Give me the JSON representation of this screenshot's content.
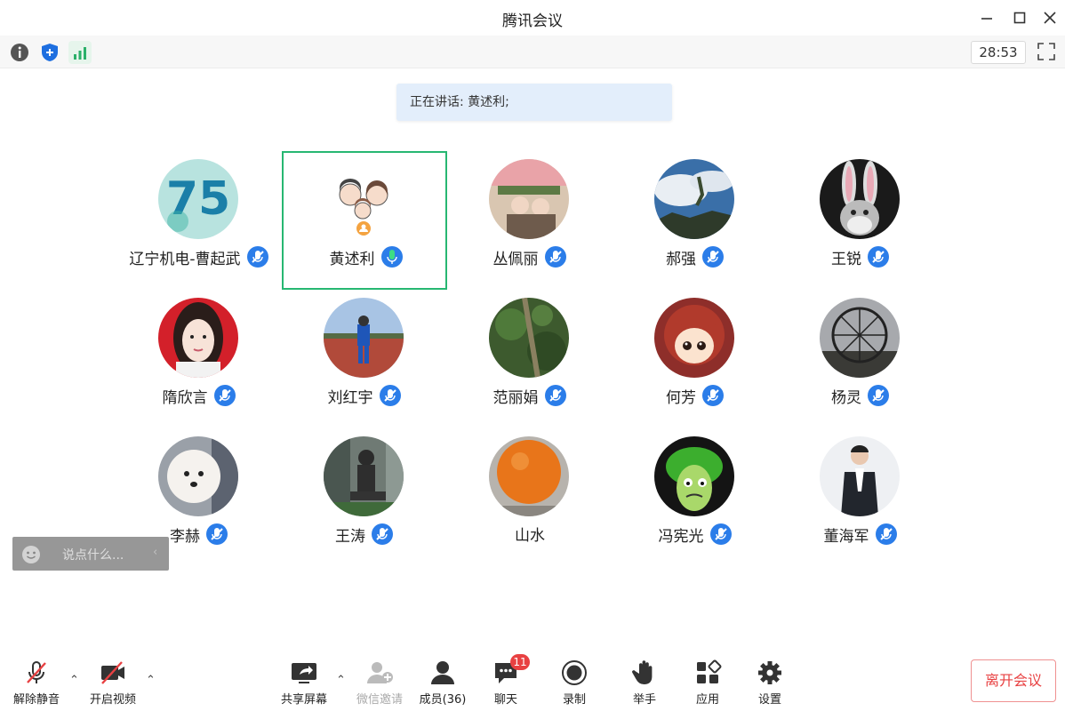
{
  "window": {
    "title": "腾讯会议"
  },
  "status": {
    "icons": [
      "info-icon",
      "security-shield-icon",
      "network-signal-icon"
    ],
    "timer": "28:53"
  },
  "banner": {
    "text": "正在讲话: 黄述利;"
  },
  "participants": [
    {
      "name": "辽宁机电-曹起武",
      "mic": "muted"
    },
    {
      "name": "黄述利",
      "mic": "speaking",
      "active": true
    },
    {
      "name": "丛佩丽",
      "mic": "muted"
    },
    {
      "name": "郝强",
      "mic": "muted"
    },
    {
      "name": "王锐",
      "mic": "muted"
    },
    {
      "name": "隋欣言",
      "mic": "muted"
    },
    {
      "name": "刘红宇",
      "mic": "muted"
    },
    {
      "name": "范丽娟",
      "mic": "muted"
    },
    {
      "name": "何芳",
      "mic": "muted"
    },
    {
      "name": "杨灵",
      "mic": "muted"
    },
    {
      "name": "李赫",
      "mic": "muted"
    },
    {
      "name": "王涛",
      "mic": "muted"
    },
    {
      "name": "山水",
      "mic": "none"
    },
    {
      "name": "冯宪光",
      "mic": "muted"
    },
    {
      "name": "董海军",
      "mic": "muted"
    }
  ],
  "chat_input": {
    "placeholder": "说点什么..."
  },
  "toolbar": {
    "unmute": "解除静音",
    "start_video": "开启视频",
    "share_screen": "共享屏幕",
    "wechat_invite": "微信邀请",
    "members": "成员(36)",
    "chat": "聊天",
    "chat_badge": "11",
    "record": "录制",
    "raise_hand": "举手",
    "apps": "应用",
    "settings": "设置"
  },
  "leave_button": "离开会议",
  "colors": {
    "accent": "#2b7de9",
    "active_border": "#27b772",
    "danger": "#e84142"
  }
}
